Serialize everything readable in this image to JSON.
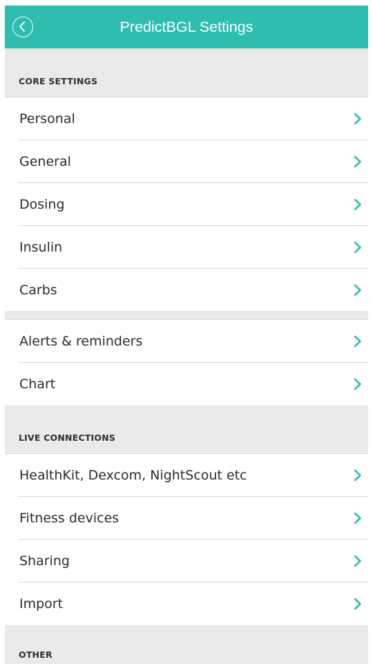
{
  "header": {
    "title": "PredictBGL Settings",
    "back_icon": "chevron-left-circle-icon",
    "accent_color": "#2ebdaf"
  },
  "sections": [
    {
      "title": "CORE SETTINGS",
      "items": [
        {
          "label": "Personal",
          "icon": "chevron-right-icon"
        },
        {
          "label": "General",
          "icon": "chevron-right-icon"
        },
        {
          "label": "Dosing",
          "icon": "chevron-right-icon"
        },
        {
          "label": "Insulin",
          "icon": "chevron-right-icon"
        },
        {
          "label": "Carbs",
          "icon": "chevron-right-icon"
        }
      ]
    },
    {
      "title": "",
      "items": [
        {
          "label": "Alerts & reminders",
          "icon": "chevron-right-icon"
        },
        {
          "label": "Chart",
          "icon": "chevron-right-icon"
        }
      ]
    },
    {
      "title": "LIVE CONNECTIONS",
      "items": [
        {
          "label": "HealthKit, Dexcom, NightScout etc",
          "icon": "chevron-right-icon"
        },
        {
          "label": "Fitness devices",
          "icon": "chevron-right-icon"
        },
        {
          "label": "Sharing",
          "icon": "chevron-right-icon"
        },
        {
          "label": "Import",
          "icon": "chevron-right-icon"
        }
      ]
    },
    {
      "title": "OTHER",
      "items": []
    }
  ]
}
